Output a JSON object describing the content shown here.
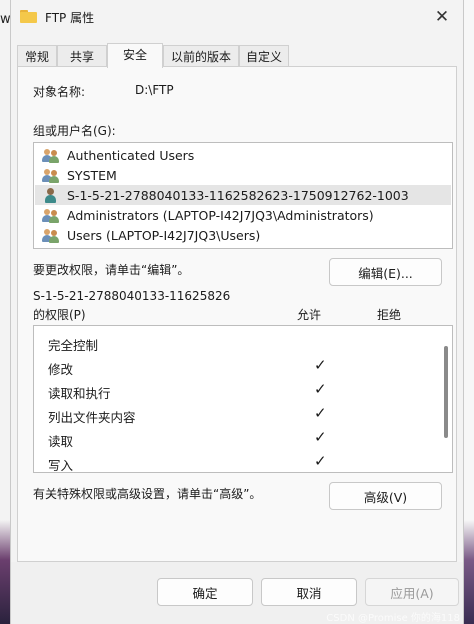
{
  "window": {
    "title": "FTP 属性",
    "close_glyph": "✕"
  },
  "background": {
    "left_text": "w"
  },
  "tabs": [
    {
      "label": "常规"
    },
    {
      "label": "共享"
    },
    {
      "label": "安全"
    },
    {
      "label": "以前的版本"
    },
    {
      "label": "自定义"
    }
  ],
  "object": {
    "label": "对象名称:",
    "value": "D:\\FTP"
  },
  "groups": {
    "label": "组或用户名(G):",
    "items": [
      {
        "name": "Authenticated Users",
        "icon": "user-group-icon"
      },
      {
        "name": "SYSTEM",
        "icon": "user-group-icon"
      },
      {
        "name": "S-1-5-21-2788040133-1162582623-1750912762-1003",
        "icon": "user-icon",
        "selected": true
      },
      {
        "name": "Administrators (LAPTOP-I42J7JQ3\\Administrators)",
        "icon": "user-group-icon"
      },
      {
        "name": "Users (LAPTOP-I42J7JQ3\\Users)",
        "icon": "user-group-icon"
      }
    ]
  },
  "edit": {
    "hint": "要更改权限，请单击“编辑”。",
    "button": "编辑(E)..."
  },
  "permissions": {
    "title_line1": "S-1-5-21-2788040133-11625826",
    "title_line2": "的权限(P)",
    "allow_label": "允许",
    "deny_label": "拒绝",
    "check_glyph": "✓",
    "rows": [
      {
        "name": "完全控制",
        "allow": false
      },
      {
        "name": "修改",
        "allow": true
      },
      {
        "name": "读取和执行",
        "allow": true
      },
      {
        "name": "列出文件夹内容",
        "allow": true
      },
      {
        "name": "读取",
        "allow": true
      },
      {
        "name": "写入",
        "allow": true
      }
    ]
  },
  "advanced": {
    "hint": "有关特殊权限或高级设置，请单击“高级”。",
    "button": "高级(V)"
  },
  "footer": {
    "ok": "确定",
    "cancel": "取消",
    "apply": "应用(A)"
  },
  "watermark": "CSDN @Promise 你的海118"
}
